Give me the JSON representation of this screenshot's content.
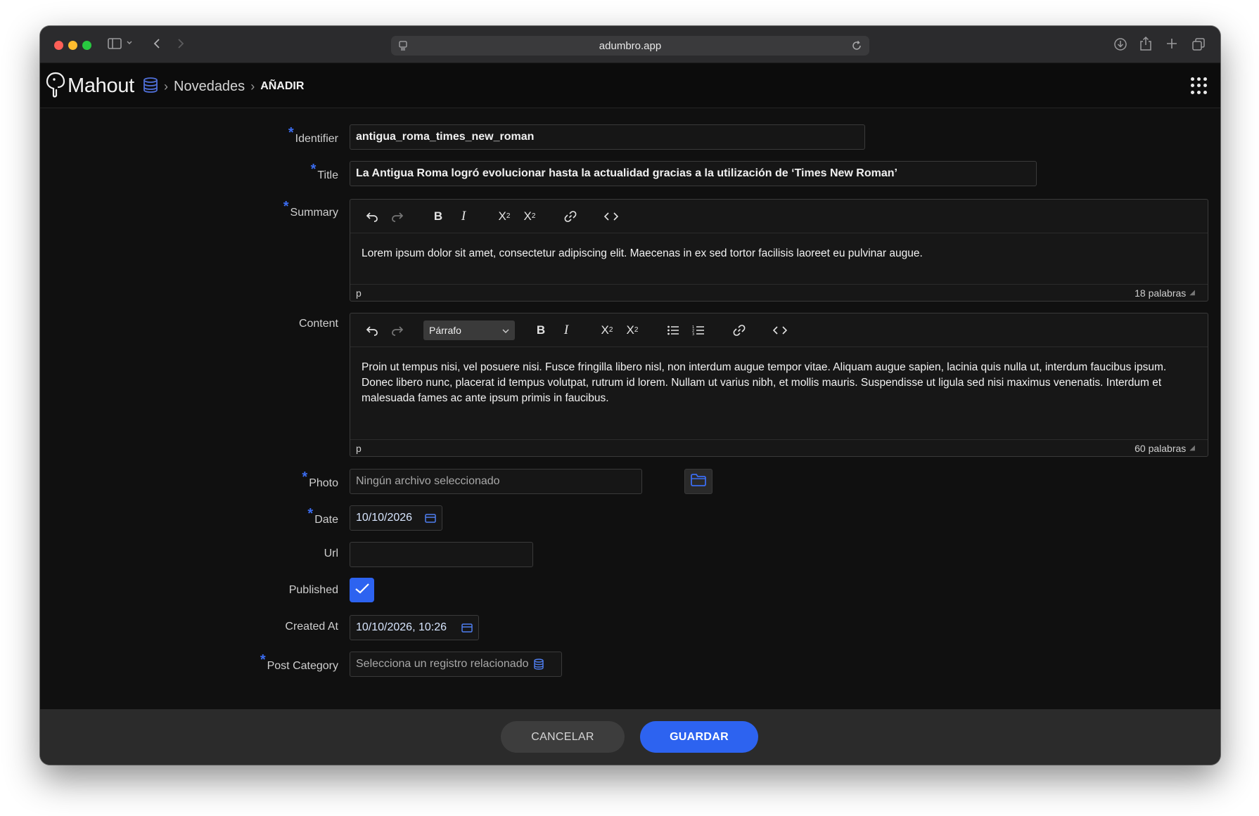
{
  "browser": {
    "url": "adumbro.app"
  },
  "header": {
    "logo_text": "Mahout",
    "breadcrumb": {
      "section": "Novedades",
      "current": "AÑADIR"
    }
  },
  "form": {
    "identifier": {
      "label": "Identifier",
      "value": "antigua_roma_times_new_roman"
    },
    "title": {
      "label": "Title",
      "value": "La Antigua Roma logró evolucionar hasta la actualidad gracias a la utilización de ‘Times New Roman’"
    },
    "summary": {
      "label": "Summary",
      "body": "Lorem ipsum dolor sit amet, consectetur adipiscing elit. Maecenas in ex sed tortor facilisis laoreet eu pulvinar augue.",
      "path": "p",
      "word_count": "18 palabras"
    },
    "content": {
      "label": "Content",
      "format_selected": "Párrafo",
      "body": "Proin ut tempus nisi, vel posuere nisi. Fusce fringilla libero nisl, non interdum augue tempor vitae. Aliquam augue sapien, lacinia quis nulla ut, interdum faucibus ipsum. Donec libero nunc, placerat id tempus volutpat, rutrum id lorem. Nullam ut varius nibh, et mollis mauris. Suspendisse ut ligula sed nisi maximus venenatis. Interdum et malesuada fames ac ante ipsum primis in faucibus.",
      "path": "p",
      "word_count": "60 palabras"
    },
    "photo": {
      "label": "Photo",
      "placeholder": "Ningún archivo seleccionado"
    },
    "date": {
      "label": "Date",
      "value": "10/10/2026"
    },
    "url": {
      "label": "Url",
      "value": ""
    },
    "published": {
      "label": "Published",
      "checked": true
    },
    "created_at": {
      "label": "Created At",
      "value": "10/10/2026, 10:26"
    },
    "post_category": {
      "label": "Post Category",
      "placeholder": "Selecciona un registro relacionado"
    },
    "required_mark": "*"
  },
  "footer": {
    "cancel_label": "CANCELAR",
    "save_label": "GUARDAR"
  },
  "colors": {
    "accent": "#2d63f0",
    "background": "#101010",
    "footer": "#2b2b2b"
  }
}
